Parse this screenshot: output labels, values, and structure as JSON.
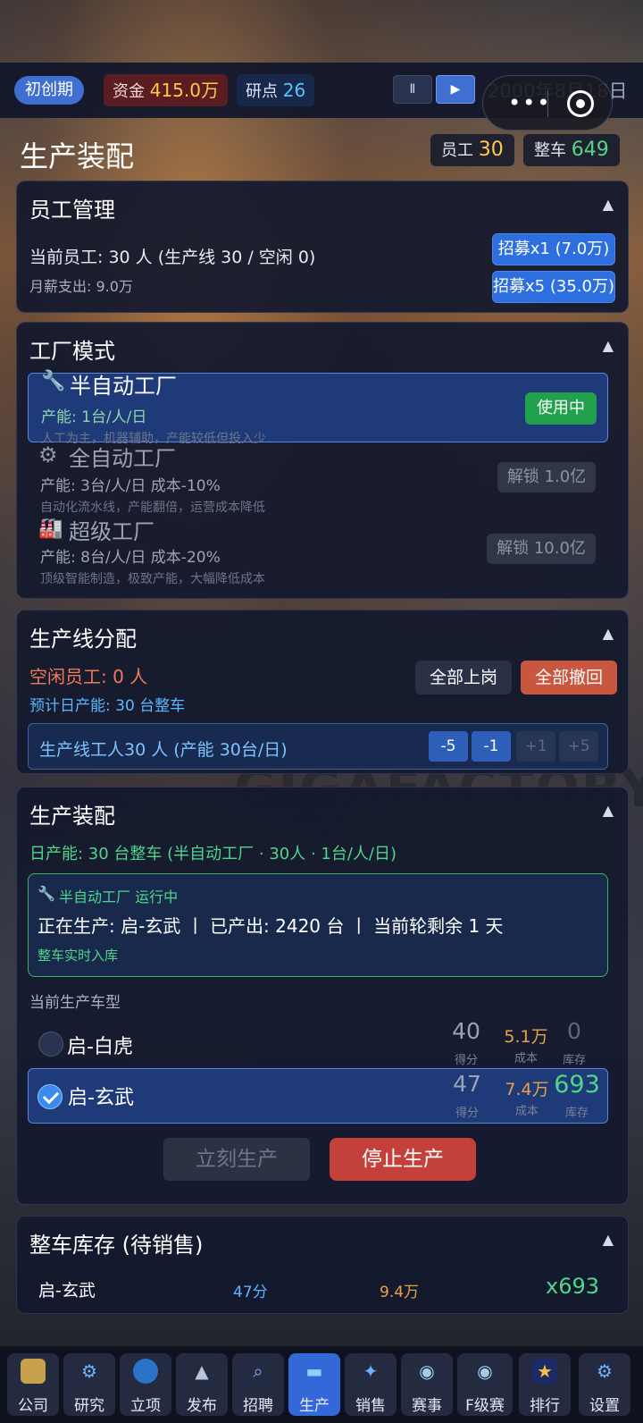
{
  "topbar": {
    "stage": "初创期",
    "fund_label": "资金",
    "fund_value": "415.0万",
    "rp_label": "研点",
    "rp_value": "26",
    "pause_icon": "Ⅱ",
    "play_icon": "▶",
    "date": "2000年8月18日"
  },
  "header": {
    "title": "生产装配",
    "staff_label": "员工",
    "staff_value": "30",
    "cars_label": "整车",
    "cars_value": "649"
  },
  "staff_card": {
    "title": "员工管理",
    "current": "当前员工: 30 人 (生产线 30 / 空闲 0)",
    "salary": "月薪支出: 9.0万",
    "recruit1": "招募x1 (7.0万)",
    "recruit5": "招募x5 (35.0万)"
  },
  "factory_card": {
    "title": "工厂模式",
    "modes": [
      {
        "name": "半自动工厂",
        "cap": "产能: 1台/人/日",
        "desc": "人工为主，机器辅助，产能较低但投入少",
        "action": "使用中"
      },
      {
        "name": "全自动工厂",
        "cap": "产能: 3台/人/日  成本-10%",
        "desc": "自动化流水线，产能翻倍，运营成本降低",
        "action": "解锁 1.0亿"
      },
      {
        "name": "超级工厂",
        "cap": "产能: 8台/人/日  成本-20%",
        "desc": "顶级智能制造，极致产能，大幅降低成本",
        "action": "解锁 10.0亿"
      }
    ]
  },
  "line_card": {
    "title": "生产线分配",
    "idle": "空闲员工: 0 人",
    "forecast": "预计日产能: 30 台整车",
    "all_on": "全部上岗",
    "all_back": "全部撤回",
    "workers": "生产线工人30 人 (产能 30台/日)",
    "steps": [
      "-5",
      "-1",
      "+1",
      "+5"
    ]
  },
  "assembly_card": {
    "title": "生产装配",
    "daily": "日产能: 30 台整车 (半自动工厂 · 30人 · 1台/人/日)",
    "status": "半自动工厂 运行中",
    "producing": "正在生产: 启-玄武 丨 已产出: 2420 台 丨 当前轮剩余 1 天",
    "realtime": "整车实时入库",
    "model_header": "当前生产车型",
    "score_label": "得分",
    "cost_label": "成本",
    "stock_label": "库存",
    "models": [
      {
        "name": "启-白虎",
        "score": "40",
        "cost": "5.1万",
        "stock": "0"
      },
      {
        "name": "启-玄武",
        "score": "47",
        "cost": "7.4万",
        "stock": "693"
      }
    ],
    "produce_now": "立刻生产",
    "stop": "停止生产"
  },
  "inventory_card": {
    "title": "整车库存 (待销售)",
    "row": {
      "name": "启-玄武",
      "score": "47分",
      "price": "9.4万",
      "qty": "x693"
    }
  },
  "nav": [
    {
      "label": "公司",
      "icon": "building-icon"
    },
    {
      "label": "研究",
      "icon": "gear-car-icon"
    },
    {
      "label": "立项",
      "icon": "monitor-icon"
    },
    {
      "label": "发布",
      "icon": "rocket-icon"
    },
    {
      "label": "招聘",
      "icon": "magnifier-icon"
    },
    {
      "label": "生产",
      "icon": "car-icon"
    },
    {
      "label": "销售",
      "icon": "sale-icon"
    },
    {
      "label": "赛事",
      "icon": "race-icon"
    },
    {
      "label": "F级赛",
      "icon": "f-race-icon"
    },
    {
      "label": "排行",
      "icon": "trophy-icon"
    },
    {
      "label": "设置",
      "icon": "settings-icon"
    }
  ],
  "colors": {
    "accent": "#2e6fe0",
    "gold": "#ffc84a",
    "green": "#4fd68a",
    "red": "#c9453b"
  }
}
